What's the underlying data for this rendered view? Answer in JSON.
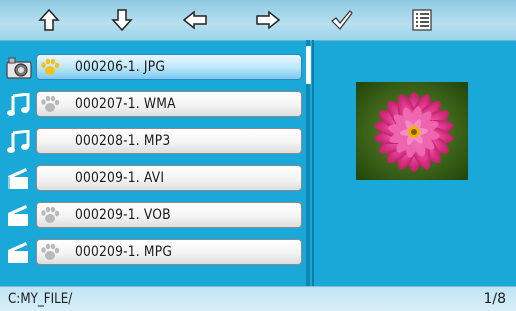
{
  "toolbar": {
    "buttons": [
      {
        "name": "up-arrow-icon"
      },
      {
        "name": "down-arrow-icon"
      },
      {
        "name": "left-arrow-icon"
      },
      {
        "name": "right-arrow-icon"
      },
      {
        "name": "checkmark-icon"
      },
      {
        "name": "list-menu-icon"
      }
    ]
  },
  "files": [
    {
      "icon": "camera-icon",
      "name": "000206-1. JPG",
      "selected": true
    },
    {
      "icon": "music-note-icon",
      "name": "000207-1. WMA",
      "selected": false
    },
    {
      "icon": "music-note-icon",
      "name": "000208-1. MP3",
      "selected": false
    },
    {
      "icon": "clapperboard-icon",
      "name": "000209-1. AVI",
      "selected": false
    },
    {
      "icon": "clapperboard-icon",
      "name": "000209-1. VOB",
      "selected": false
    },
    {
      "icon": "clapperboard-icon",
      "name": "000209-1. MPG",
      "selected": false
    }
  ],
  "preview": {
    "subject": "pink dahlia flower photo"
  },
  "status": {
    "path": "C:MY_FILE/",
    "page": "1/8"
  },
  "colors": {
    "background": "#1aa8d8",
    "selected_bar": "#79c9ef",
    "thumb_yellow": "#f3c21a"
  }
}
